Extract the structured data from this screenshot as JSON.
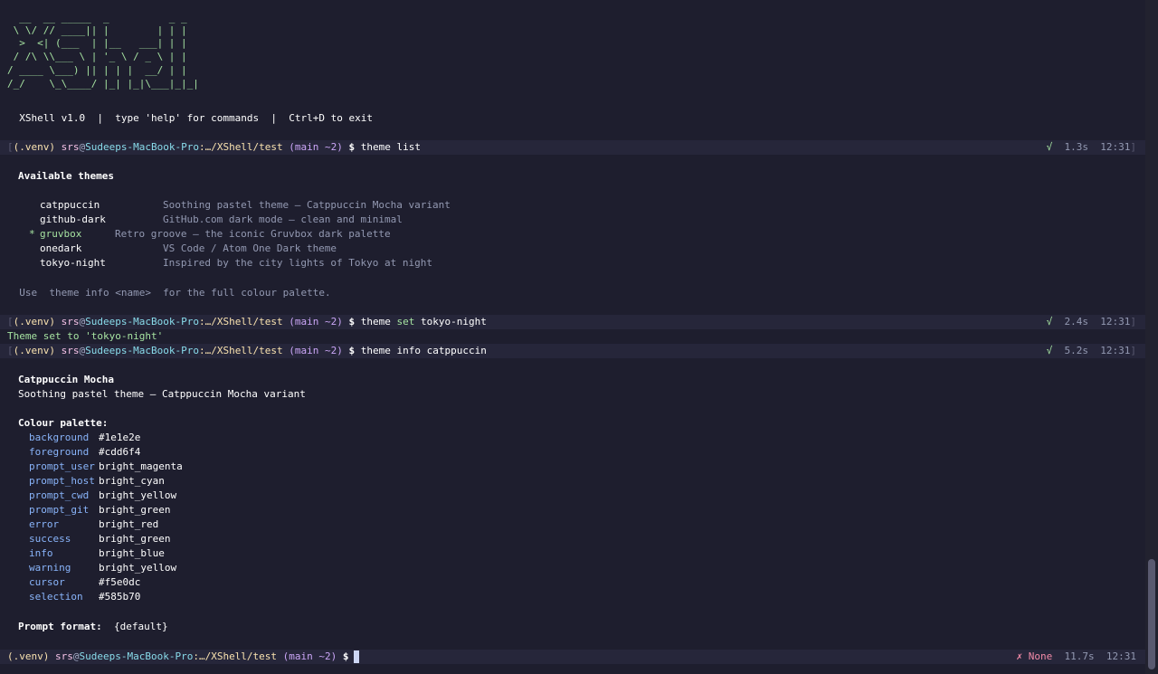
{
  "banner": [
    "  __  __ _____  _          _ _",
    " \\ \\/ // ____|| |        | | |",
    "  >  <| (___  | |__   ___| | |",
    " / /\\ \\\\___ \\ | '_ \\ / _ \\ | |",
    "/ ____ \\___) || | | |  __/ | |",
    "/_/    \\_\\____/ |_| |_|\\___|_|_|"
  ],
  "intro": "  XShell v1.0  |  type 'help' for commands  |  Ctrl+D to exit",
  "prompt": {
    "venv": "(.venv)",
    "user": "srs",
    "at": "@",
    "host": "Sudeeps-MacBook-Pro",
    "cwd": ":…/XShell/test",
    "git": "(main ~2)",
    "dollar": "$"
  },
  "commands": [
    {
      "text": "theme list",
      "status": "√",
      "duration": "1.3s",
      "time": "12:31"
    },
    {
      "pre": "theme ",
      "kw": "set",
      "post": " tokyo-night",
      "status": "√",
      "duration": "2.4s",
      "time": "12:31"
    },
    {
      "text": "theme info catppuccin",
      "status": "√",
      "duration": "5.2s",
      "time": "12:31"
    }
  ],
  "themes_heading": "Available themes",
  "themes": [
    {
      "marker": "",
      "name": "catppuccin",
      "desc": "Soothing pastel theme — Catppuccin Mocha variant"
    },
    {
      "marker": "",
      "name": "github-dark",
      "desc": "GitHub.com dark mode — clean and minimal"
    },
    {
      "marker": "*",
      "name": "gruvbox",
      "desc": "Retro groove — the iconic Gruvbox dark palette"
    },
    {
      "marker": "",
      "name": "onedark",
      "desc": "VS Code / Atom One Dark theme"
    },
    {
      "marker": "",
      "name": "tokyo-night",
      "desc": "Inspired by the city lights of Tokyo at night"
    }
  ],
  "use_hint": "  Use  theme info <name>  for the full colour palette.",
  "set_result": "Theme set to 'tokyo-night'",
  "info": {
    "name": "Catppuccin Mocha",
    "desc": "Soothing pastel theme — Catppuccin Mocha variant",
    "palette_heading": "Colour palette:",
    "palette": [
      {
        "key": "background",
        "value": "#1e1e2e"
      },
      {
        "key": "foreground",
        "value": "#cdd6f4"
      },
      {
        "key": "prompt_user",
        "value": "bright_magenta"
      },
      {
        "key": "prompt_host",
        "value": "bright_cyan"
      },
      {
        "key": "prompt_cwd",
        "value": "bright_yellow"
      },
      {
        "key": "prompt_git",
        "value": "bright_green"
      },
      {
        "key": "error",
        "value": "bright_red"
      },
      {
        "key": "success",
        "value": "bright_green"
      },
      {
        "key": "info",
        "value": "bright_blue"
      },
      {
        "key": "warning",
        "value": "bright_yellow"
      },
      {
        "key": "cursor",
        "value": "#f5e0dc"
      },
      {
        "key": "selection",
        "value": "#585b70"
      }
    ],
    "prompt_format_label": "Prompt format:",
    "prompt_format_value": "{default}"
  },
  "last_status": {
    "status": "✗ None",
    "duration": "11.7s",
    "time": "12:31"
  },
  "colors": {
    "background": "#1e1e2e",
    "foreground": "#cdd6f4",
    "success": "#a6e3a1",
    "error": "#f38ba8"
  }
}
